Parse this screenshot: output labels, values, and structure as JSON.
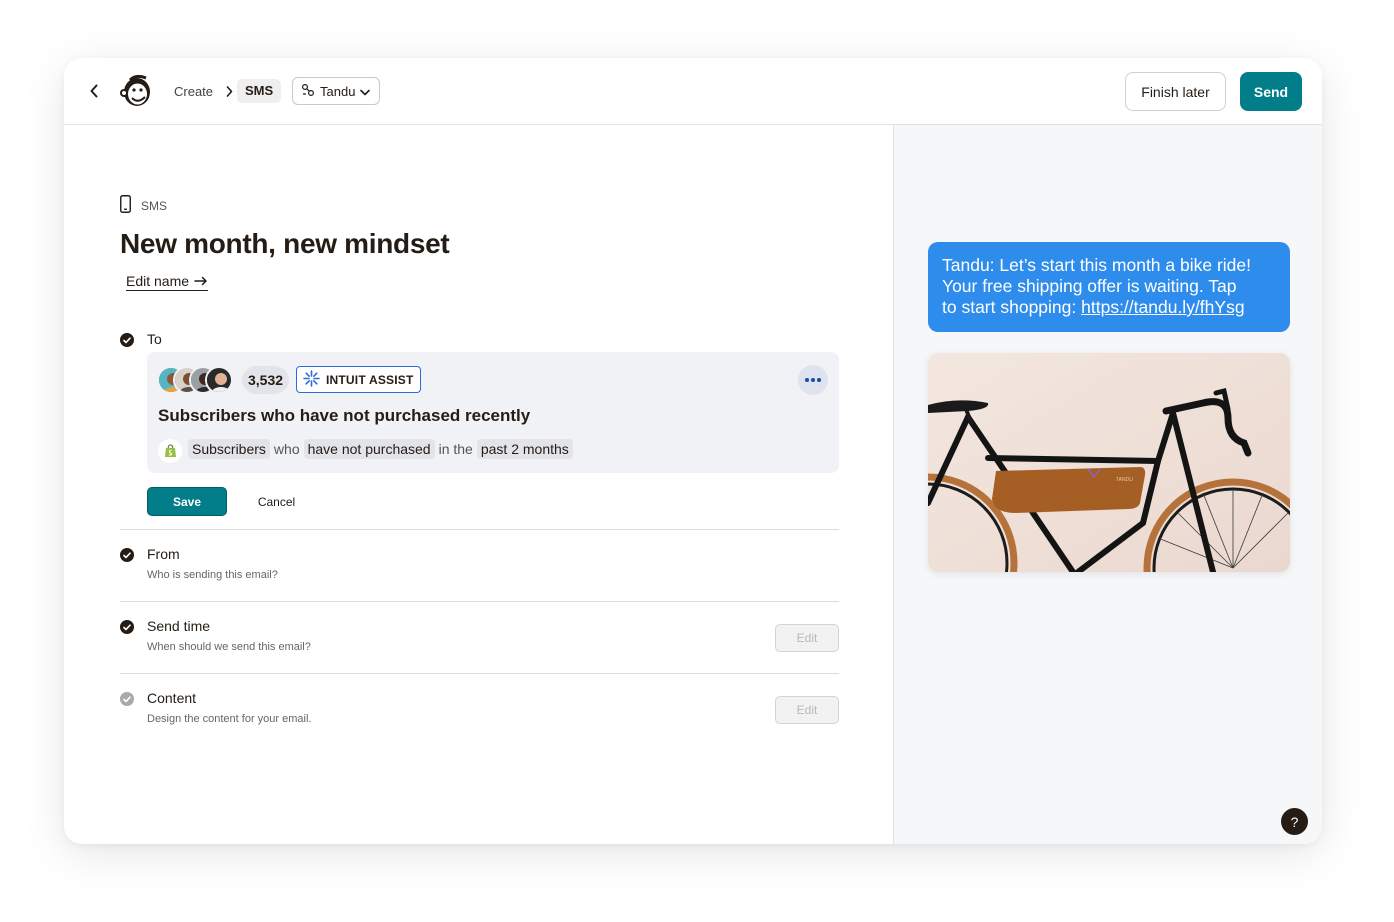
{
  "header": {
    "breadcrumb": {
      "create": "Create",
      "current": "SMS"
    },
    "brand": "Tandu",
    "finish_later": "Finish later",
    "send": "Send"
  },
  "campaign": {
    "channel_label": "SMS",
    "title": "New month, new mindset",
    "edit_name": "Edit name"
  },
  "to": {
    "label": "To",
    "audience_count": "3,532",
    "assist_label": "INTUIT ASSIST",
    "segment_title": "Subscribers who have not purchased recently",
    "condition": {
      "subject": "Subscribers",
      "w1": "who",
      "action": "have not purchased",
      "w2": "in the",
      "range": "past 2 months"
    },
    "save": "Save",
    "cancel": "Cancel"
  },
  "sections": {
    "from": {
      "label": "From",
      "sub": "Who is sending this email?"
    },
    "send_time": {
      "label": "Send time",
      "sub": "When should we send this email?",
      "edit": "Edit"
    },
    "content": {
      "label": "Content",
      "sub": "Design the content for your email.",
      "edit": "Edit"
    }
  },
  "preview": {
    "line1": "Tandu: Let’s start this month a bike ride!",
    "line2": "Your free shipping offer is waiting. Tap",
    "line3_prefix": "to start shopping: ",
    "link": "https://tandu.ly/fhYsg",
    "bag_brand": "TANDU"
  },
  "help": "?",
  "colors": {
    "accent": "#017e89",
    "bubble": "#2e8cec",
    "intuit_border": "#2d6bd8",
    "text": "#241c15"
  }
}
